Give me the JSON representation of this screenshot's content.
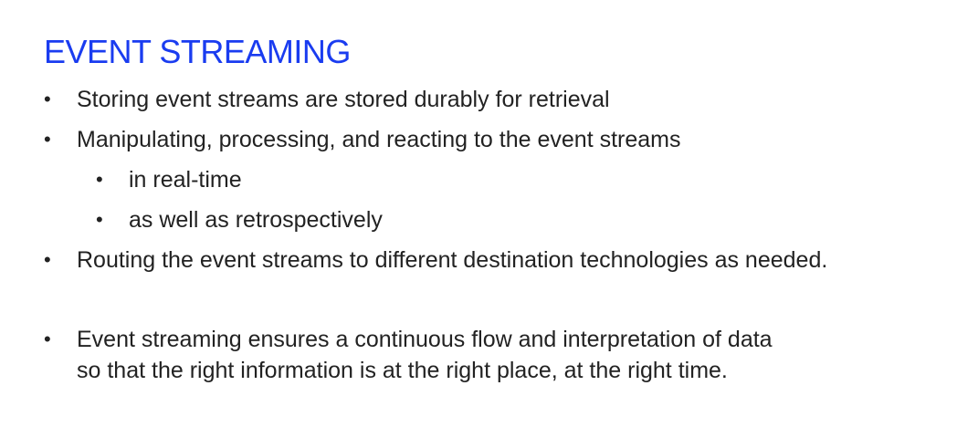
{
  "slide": {
    "title": "EVENT STREAMING",
    "bullet_glyph": "•",
    "bullets": [
      {
        "text": "Storing event streams are stored durably for retrieval"
      },
      {
        "text": "Manipulating, processing, and reacting to the event streams"
      },
      {
        "text": "in real-time"
      },
      {
        "text": "as well as retrospectively"
      },
      {
        "text": "Routing the event streams to different destination technologies as needed."
      },
      {
        "line1": "Event streaming ensures a continuous flow and interpretation of data",
        "line2": "so that the right information is at the right place, at the right time."
      }
    ]
  },
  "colors": {
    "title": "#1a3cf0",
    "body_text": "#222222",
    "background": "#ffffff"
  }
}
